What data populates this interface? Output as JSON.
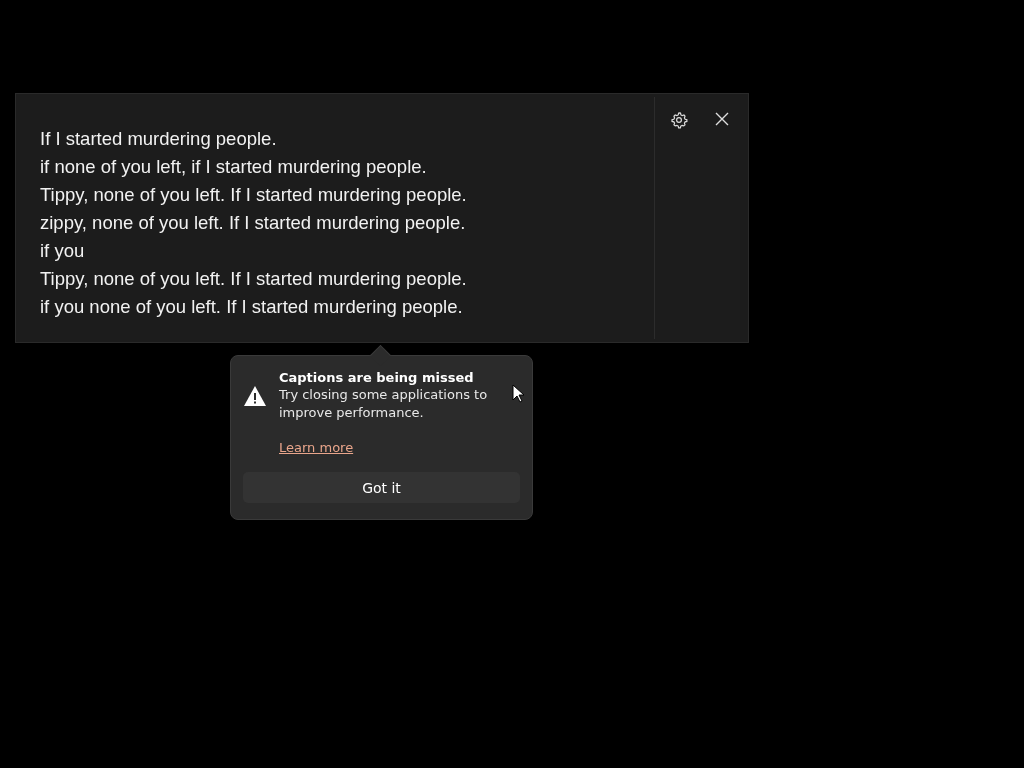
{
  "caption_window": {
    "lines": [
      "If I started murdering people.",
      "if none of you left, if I started murdering people.",
      "Tippy, none of you left. If I started murdering people.",
      "zippy, none of you left. If I started murdering people.",
      "if you",
      "Tippy, none of you left. If I started murdering people.",
      "if you none of you left. If I started murdering people."
    ]
  },
  "teaching_tip": {
    "title": "Captions are being missed",
    "message": "Try closing some applications to improve performance.",
    "link": "Learn more",
    "button": "Got it"
  }
}
